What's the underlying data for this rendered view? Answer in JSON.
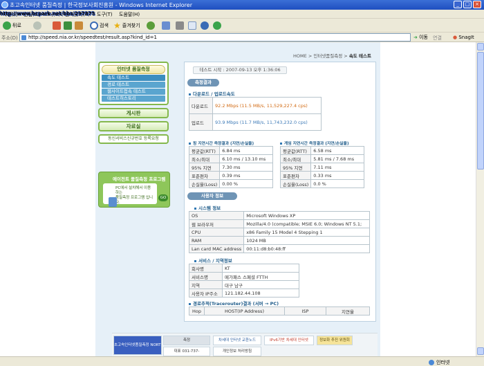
{
  "window": {
    "title": "초고속인터넷 품질측정 | 한국정보사회진흥원 - Windows Internet Explorer",
    "watermark": "http://www.bcpark.net/bbs/297875"
  },
  "menu": [
    "파일(F)",
    "편집(E)",
    "보기(V)",
    "즐겨찾기(A)",
    "도구(T)",
    "도움말(H)"
  ],
  "toolbar": {
    "back": "뒤로",
    "search": "검색",
    "favorites": "즐겨찾기"
  },
  "address": {
    "label": "주소(D)",
    "url": "http://speed.nia.or.kr/speedtest/result.asp?kind_id=1",
    "go": "이동",
    "links": "연결",
    "snagit": "SnagIt"
  },
  "status": {
    "zone": "인터넷"
  },
  "breadcrumb": {
    "home": "HOME",
    "sep": ">",
    "section": "인터넷품질측정",
    "current": "속도 테스트"
  },
  "nav": {
    "header": "인터넷 품질측정",
    "items": [
      "속도 테스트",
      "경로 테스트",
      "웹사이트접속 테스트",
      "테스트히스토리"
    ],
    "board": "게시판",
    "archive": "자료실",
    "signup": "동신서비스신규번호 등록요청"
  },
  "promo": {
    "title": "에이전트 품질측정 프로그램",
    "desc1": "PC에서 설치해서 이용하는",
    "desc2": "품질측정 프로그램 입니다.",
    "go": "GO"
  },
  "result": {
    "start_time": "테스트 시작 : 2007-09-13 오후 1:36:06",
    "section_result": "측정결과",
    "dl_ul_title": "다운로드 / 업로드속도",
    "download_label": "다운로드",
    "download_value": "92.2 Mbps (11.5 MB/s, 11,529,227.4 cps)",
    "upload_label": "업로드",
    "upload_value": "93.9 Mbps (11.7 MB/s, 11,743,232.0 cps)",
    "ping_title": "핑 지연시간 측정결과 (지연/손실율)",
    "gate_title": "게임 지연시간 측정결과 (지연/손실율)",
    "ping_rows": [
      {
        "k": "평균값(RTT)",
        "v": "6.84 ms"
      },
      {
        "k": "최소/최대",
        "v": "6.10 ms / 13.10 ms"
      },
      {
        "k": "95% 지연",
        "v": "7.30 ms"
      },
      {
        "k": "표준편차",
        "v": "0.39 ms"
      },
      {
        "k": "손실율(Loss)",
        "v": "0.00 %"
      }
    ],
    "gate_rows": [
      {
        "k": "평균값(RTT)",
        "v": "6.58 ms"
      },
      {
        "k": "최소/최대",
        "v": "5.81 ms / 7.68 ms"
      },
      {
        "k": "95% 지연",
        "v": "7.11 ms"
      },
      {
        "k": "표준편차",
        "v": "0.33 ms"
      },
      {
        "k": "손실율(Loss)",
        "v": "0.0 %"
      }
    ],
    "section_user": "사용자 정보",
    "sys_title": "시스템 정보",
    "sys_rows": [
      {
        "k": "OS",
        "v": "Microsoft Windows XP"
      },
      {
        "k": "웹 브라우저",
        "v": "Mozilla/4.0 (compatible; MSIE 6.0; Windows NT 5.1;"
      },
      {
        "k": "CPU",
        "v": "x86 Family 15 Model 4 Stepping 1"
      },
      {
        "k": "RAM",
        "v": "1024 MB"
      },
      {
        "k": "Lan card MAC address",
        "v": "00:11:d8:b0:48:ff"
      }
    ],
    "svc_title": "서비스 / 지역정보",
    "svc_rows": [
      {
        "k": "회사명",
        "v": "KT"
      },
      {
        "k": "서비스명",
        "v": "메가패스 스페셜 FTTH"
      },
      {
        "k": "지역",
        "v": "대구 남구"
      },
      {
        "k": "사용자 IP주소",
        "v": "121.182.44.108"
      }
    ],
    "trace_title": "경로추적(Tracerouter)결과 (서버 → PC)",
    "trace_headers": [
      "Hop",
      "HOST(IP Address)",
      "ISP",
      "지연율"
    ]
  },
  "footer": {
    "b1": "초고속인터넷품질측정 NORTH",
    "b2": "측정",
    "b3": "차세대 인터넷 교환노드",
    "b4": "IPv6기반 차세대 인터넷",
    "b5": "정보화 추진 위원회",
    "b6": "대표 031-737-",
    "b7": "개인정보 처리방침"
  }
}
